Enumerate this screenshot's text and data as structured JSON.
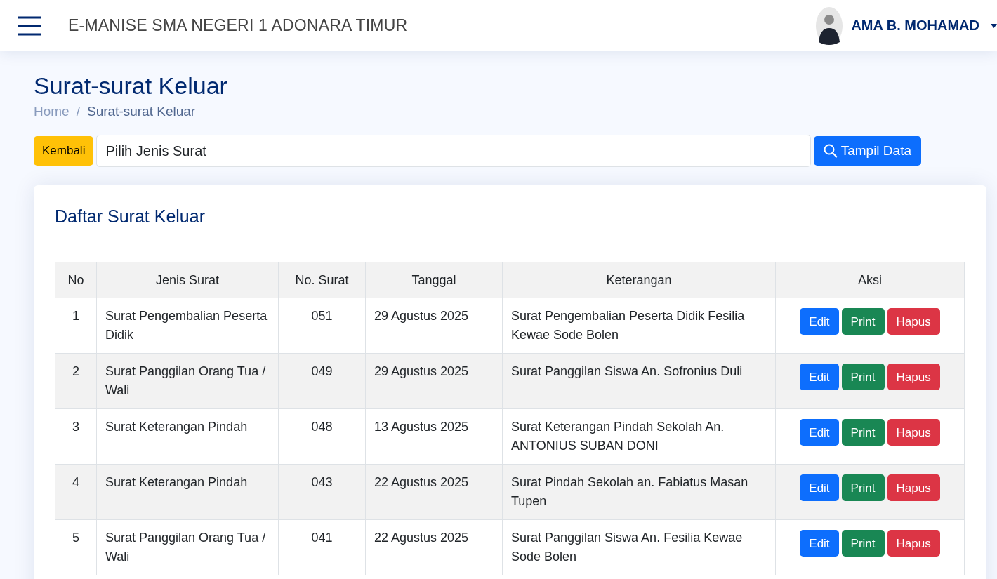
{
  "header": {
    "app_title": "E-MANISE SMA NEGERI 1 ADONARA TIMUR",
    "user_name": "AMA B. MOHAMAD"
  },
  "page": {
    "title": "Surat-surat Keluar",
    "breadcrumb_separator": "/",
    "breadcrumb": [
      {
        "label": "Home",
        "selected": false
      },
      {
        "label": "Surat-surat Keluar",
        "selected": true
      }
    ]
  },
  "filter": {
    "back_button": "Kembali",
    "select_value": "Pilih Jenis Surat",
    "submit_button": "Tampil Data"
  },
  "card": {
    "title": "Daftar Surat Keluar",
    "table": {
      "columns": [
        "No",
        "Jenis Surat",
        "No. Surat",
        "Tanggal",
        "Keterangan",
        "Aksi"
      ],
      "rows": [
        {
          "no": "1",
          "type": "Surat Pengembalian Peserta Didik",
          "number": "051",
          "date": "29 Agustus 2025",
          "note": "Surat Pengembalian Peserta Didik Fesilia Kewae Sode Bolen",
          "actions": [
            {
              "kind": "edit",
              "label": "Edit"
            },
            {
              "kind": "print",
              "label": "Print"
            },
            {
              "kind": "delete",
              "label": "Hapus"
            }
          ]
        },
        {
          "no": "2",
          "type": "Surat Panggilan Orang Tua / Wali",
          "number": "049",
          "date": "29 Agustus 2025",
          "note": "Surat Panggilan Siswa An. Sofronius Duli",
          "actions": [
            {
              "kind": "edit",
              "label": "Edit"
            },
            {
              "kind": "print",
              "label": "Print"
            },
            {
              "kind": "delete",
              "label": "Hapus"
            }
          ]
        },
        {
          "no": "3",
          "type": "Surat Keterangan Pindah",
          "number": "048",
          "date": "13 Agustus 2025",
          "note": "Surat Keterangan Pindah Sekolah An. ANTONIUS SUBAN DONI",
          "actions": [
            {
              "kind": "edit",
              "label": "Edit"
            },
            {
              "kind": "print",
              "label": "Print"
            },
            {
              "kind": "delete",
              "label": "Hapus"
            }
          ]
        },
        {
          "no": "4",
          "type": "Surat Keterangan Pindah",
          "number": "043",
          "date": "22 Agustus 2025",
          "note": "Surat Pindah Sekolah an. Fabiatus Masan Tupen",
          "actions": [
            {
              "kind": "edit",
              "label": "Edit"
            },
            {
              "kind": "print",
              "label": "Print"
            },
            {
              "kind": "delete",
              "label": "Hapus"
            }
          ]
        },
        {
          "no": "5",
          "type": "Surat Panggilan Orang Tua / Wali",
          "number": "041",
          "date": "22 Agustus 2025",
          "note": "Surat Panggilan Siswa An. Fesilia Kewae Sode Bolen",
          "actions": [
            {
              "kind": "edit",
              "label": "Edit"
            },
            {
              "kind": "print",
              "label": "Print"
            },
            {
              "kind": "delete",
              "label": "Hapus"
            }
          ]
        }
      ]
    }
  }
}
